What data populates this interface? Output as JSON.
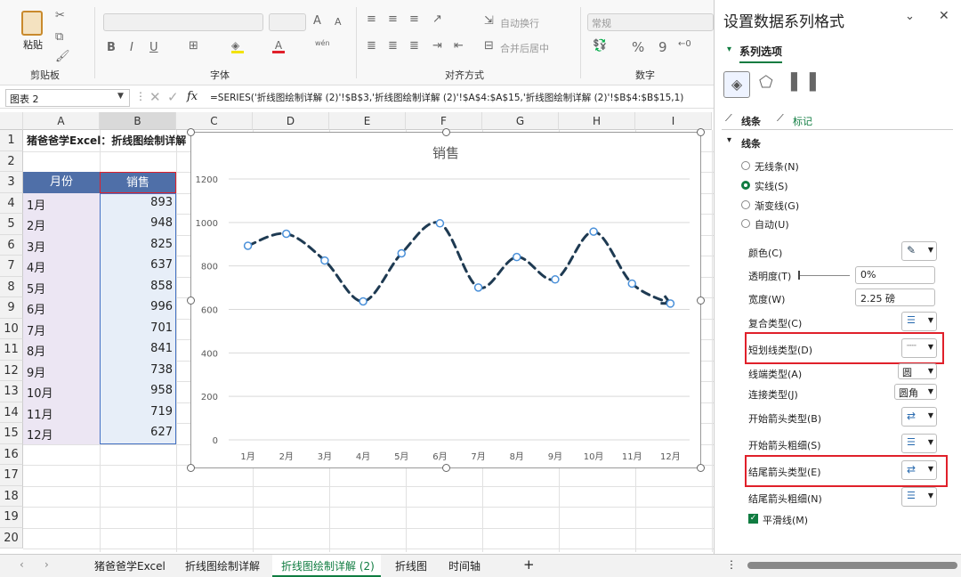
{
  "ribbon": {
    "paste": "粘贴",
    "clipboard": "剪贴板",
    "font": "字体",
    "align": "对齐方式",
    "number": "数字",
    "wrap": "自动换行",
    "merge": "合并后居中",
    "format": "常规",
    "bold": "B",
    "italic": "I",
    "underline": "U",
    "percent": "%",
    "comma": "9",
    "grow": "A",
    "shrink": "A",
    "wen": "wén"
  },
  "formula_bar": {
    "name": "图表 2",
    "fx": "fx",
    "formula": "=SERIES('折线图绘制详解 (2)'!$B$3,'折线图绘制详解 (2)'!$A$4:$A$15,'折线图绘制详解 (2)'!$B$4:$B$15,1)"
  },
  "sheet": {
    "columns": [
      "A",
      "B",
      "C",
      "D",
      "E",
      "F",
      "G",
      "H",
      "I"
    ],
    "rows": [
      "1",
      "2",
      "3",
      "4",
      "5",
      "6",
      "7",
      "8",
      "9",
      "10",
      "11",
      "12",
      "13",
      "14",
      "15",
      "16",
      "17",
      "18",
      "19",
      "20"
    ],
    "title": "猪爸爸学Excel：折线图绘制详解",
    "header_month": "月份",
    "header_sales": "销售",
    "months": [
      "1月",
      "2月",
      "3月",
      "4月",
      "5月",
      "6月",
      "7月",
      "8月",
      "9月",
      "10月",
      "11月",
      "12月"
    ],
    "sales": [
      "893",
      "948",
      "825",
      "637",
      "858",
      "996",
      "701",
      "841",
      "738",
      "958",
      "719",
      "627"
    ]
  },
  "chart_data": {
    "type": "line",
    "title": "销售",
    "categories": [
      "1月",
      "2月",
      "3月",
      "4月",
      "5月",
      "6月",
      "7月",
      "8月",
      "9月",
      "10月",
      "11月",
      "12月"
    ],
    "series": [
      {
        "values": [
          893,
          948,
          825,
          637,
          858,
          996,
          701,
          841,
          738,
          958,
          719,
          627
        ]
      }
    ],
    "yticks": [
      "0",
      "200",
      "400",
      "600",
      "800",
      "1000",
      "1200"
    ],
    "ylim": [
      0,
      1200
    ],
    "grid": true,
    "smooth": true,
    "line_color": "#1e3a52"
  },
  "pane": {
    "title": "设置数据系列格式",
    "section": "系列选项",
    "tab_line": "线条",
    "tab_marker": "标记",
    "line_section": "线条",
    "options": [
      "无线条(N)",
      "实线(S)",
      "渐变线(G)",
      "自动(U)"
    ],
    "color": "颜色(C)",
    "transparency": "透明度(T)",
    "transparency_value": "0%",
    "width": "宽度(W)",
    "width_value": "2.25 磅",
    "compound": "复合类型(C)",
    "dash": "短划线类型(D)",
    "cap": "线端类型(A)",
    "cap_value": "圆",
    "join": "连接类型(J)",
    "join_value": "圆角",
    "begin_arrow": "开始箭头类型(B)",
    "begin_size": "开始箭头粗细(S)",
    "end_arrow": "结尾箭头类型(E)",
    "end_size": "结尾箭头粗细(N)",
    "smooth": "平滑线(M)"
  },
  "tabs": [
    "猪爸爸学Excel",
    "折线图绘制详解",
    "折线图绘制详解 (2)",
    "折线图",
    "时间轴"
  ],
  "colors": {
    "accent": "#107c41",
    "header_fill": "#4f6fa8",
    "red": "#e0202a"
  }
}
